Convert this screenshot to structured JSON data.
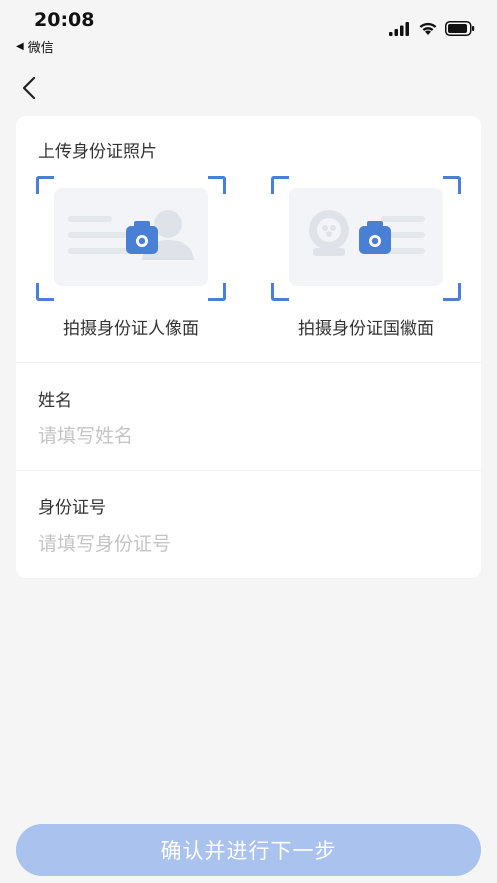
{
  "status_bar": {
    "time": "20:08",
    "back_app_label": "微信"
  },
  "upload": {
    "title": "上传身份证照片",
    "front_caption": "拍摄身份证人像面",
    "back_caption": "拍摄身份证国徽面"
  },
  "form": {
    "name_label": "姓名",
    "name_placeholder": "请填写姓名",
    "name_value": "",
    "id_label": "身份证号",
    "id_placeholder": "请填写身份证号",
    "id_value": ""
  },
  "footer": {
    "confirm_label": "确认并进行下一步"
  },
  "colors": {
    "accent": "#4a7fd6",
    "button_disabled": "#a9c2ee",
    "background": "#f5f5f5",
    "card": "#ffffff",
    "placeholder": "#c4c4c4"
  },
  "icons": [
    "back-arrow-icon",
    "signal-icon",
    "wifi-icon",
    "battery-icon",
    "camera-icon",
    "portrait-icon",
    "emblem-icon"
  ]
}
